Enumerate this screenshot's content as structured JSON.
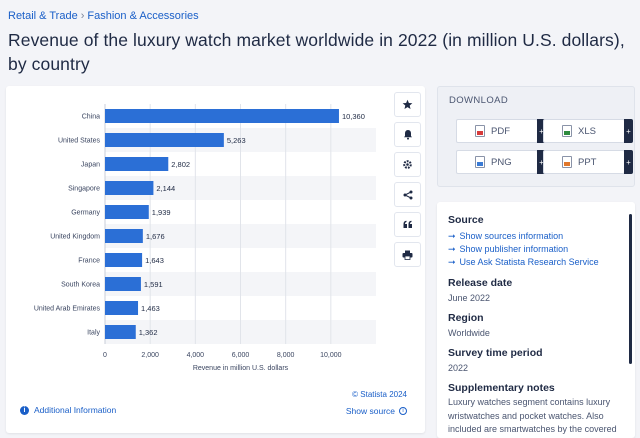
{
  "breadcrumb": {
    "part1": "Retail & Trade",
    "separator": "›",
    "part2": "Fashion & Accessories"
  },
  "page_title": "Revenue of the luxury watch market worldwide in 2022 (in million U.S. dollars), by country",
  "chart_data": {
    "type": "bar",
    "orientation": "horizontal",
    "categories": [
      "China",
      "United States",
      "Japan",
      "Singapore",
      "Germany",
      "United Kingdom",
      "France",
      "South Korea",
      "United Arab Emirates",
      "Italy"
    ],
    "values": [
      10360,
      5263,
      2802,
      2144,
      1939,
      1676,
      1643,
      1591,
      1463,
      1362
    ],
    "value_labels": [
      "10,360",
      "5,263",
      "2,802",
      "2,144",
      "1,939",
      "1,676",
      "1,643",
      "1,591",
      "1,463",
      "1,362"
    ],
    "xlim": [
      0,
      12000
    ],
    "xticks": [
      0,
      2000,
      4000,
      6000,
      8000,
      10000
    ],
    "xtick_labels": [
      "0",
      "2,000",
      "4,000",
      "6,000",
      "8,000",
      "10,000"
    ],
    "xlabel": "Revenue in million U.S. dollars",
    "ylabel": "",
    "title": "",
    "bar_color": "#2b6fd6",
    "grid": true,
    "striped_rows": true
  },
  "chart_footer": {
    "credit": "© Statista 2024",
    "additional_info": "Additional Information",
    "show_source": "Show source"
  },
  "toolbar": {
    "icons": [
      "star-icon",
      "bell-icon",
      "gear-icon",
      "share-icon",
      "quote-icon",
      "print-icon"
    ]
  },
  "download": {
    "title": "DOWNLOAD",
    "buttons": [
      {
        "label": "PDF",
        "icon": "pdf-icon"
      },
      {
        "label": "XLS",
        "icon": "xls-icon"
      },
      {
        "label": "PNG",
        "icon": "png-icon"
      },
      {
        "label": "PPT",
        "icon": "ppt-icon"
      }
    ],
    "plus": "+"
  },
  "source_panel": {
    "source_title": "Source",
    "links": [
      "Show sources information",
      "Show publisher information",
      "Use Ask Statista Research Service"
    ],
    "release_title": "Release date",
    "release_value": "June 2022",
    "region_title": "Region",
    "region_value": "Worldwide",
    "survey_title": "Survey time period",
    "survey_value": "2022",
    "supp_title": "Supplementary notes",
    "supp_text": "Luxury watches segment contains luxury wristwatches and pocket watches. Also included are smartwatches by the covered"
  },
  "colors": {
    "accent": "#1a5fc8",
    "bar": "#2b6fd6",
    "text": "#1f2a44",
    "background": "#f3f4f8"
  }
}
